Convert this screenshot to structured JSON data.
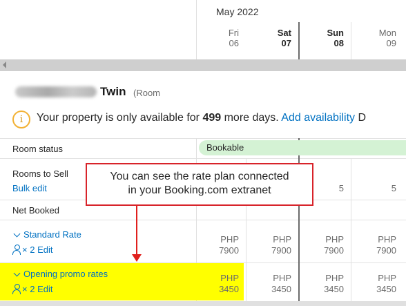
{
  "calendar": {
    "month": "May 2022",
    "days": [
      {
        "name": "Fri",
        "date": "06",
        "bold": false
      },
      {
        "name": "Sat",
        "date": "07",
        "bold": true
      },
      {
        "name": "Sun",
        "date": "08",
        "bold": true
      },
      {
        "name": "Mon",
        "date": "09",
        "bold": false
      }
    ]
  },
  "room": {
    "title": "Twin",
    "subtitle": "(Room"
  },
  "notice": {
    "text_before": "Your property is only available for ",
    "days": "499",
    "text_after": " more days. ",
    "link": "Add availability",
    "trailing": " D"
  },
  "rows": {
    "room_status": "Room status",
    "status_value": "Bookable",
    "rooms_to_sell": "Rooms to Sell",
    "bulk_edit": "Bulk edit",
    "rooms_values": [
      "5",
      "5"
    ],
    "net_booked": "Net Booked"
  },
  "rate_plans": [
    {
      "name": "Standard Rate",
      "occupancy": "× 2",
      "edit": "Edit",
      "prices": [
        {
          "currency": "PHP",
          "amount": "7900"
        },
        {
          "currency": "PHP",
          "amount": "7900"
        },
        {
          "currency": "PHP",
          "amount": "7900"
        },
        {
          "currency": "PHP",
          "amount": "7900"
        }
      ]
    },
    {
      "name": "Opening promo rates",
      "occupancy": "× 2",
      "edit": "Edit",
      "prices": [
        {
          "currency": "PHP",
          "amount": "3450"
        },
        {
          "currency": "PHP",
          "amount": "3450"
        },
        {
          "currency": "PHP",
          "amount": "3450"
        },
        {
          "currency": "PHP",
          "amount": "3450"
        }
      ]
    }
  ],
  "callout": {
    "line1": "You can see the rate plan connected",
    "line2": "in your Booking.com extranet"
  },
  "colors": {
    "link": "#0071c2",
    "bookable_bg": "#d4f2d4",
    "highlight": "#ffff00",
    "callout_border": "#d8232a",
    "info_icon": "#f2b134"
  },
  "icons": [
    "chevron-left-icon",
    "info-icon",
    "chevron-down-icon",
    "person-icon"
  ]
}
